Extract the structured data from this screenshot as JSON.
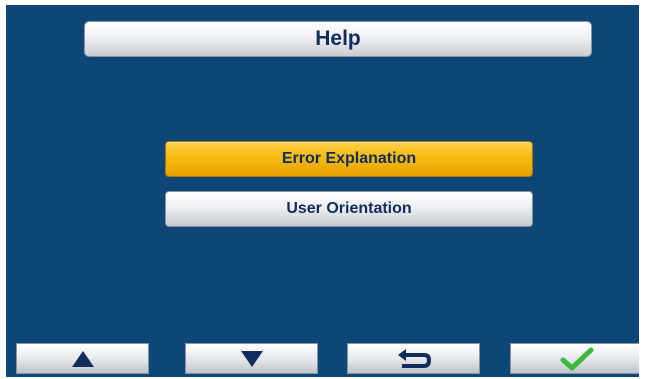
{
  "header": {
    "title": "Help"
  },
  "menu": {
    "items": [
      {
        "label": "Error Explanation",
        "selected": true
      },
      {
        "label": "User Orientation",
        "selected": false
      }
    ]
  },
  "footer": {
    "buttons": [
      {
        "icon": "arrow-up-icon"
      },
      {
        "icon": "arrow-down-icon"
      },
      {
        "icon": "return-icon"
      },
      {
        "icon": "checkmark-icon"
      }
    ]
  },
  "colors": {
    "background": "#0f4678",
    "selected": "#f5ba12",
    "text": "#102d5c",
    "confirm": "#3cb83a"
  }
}
